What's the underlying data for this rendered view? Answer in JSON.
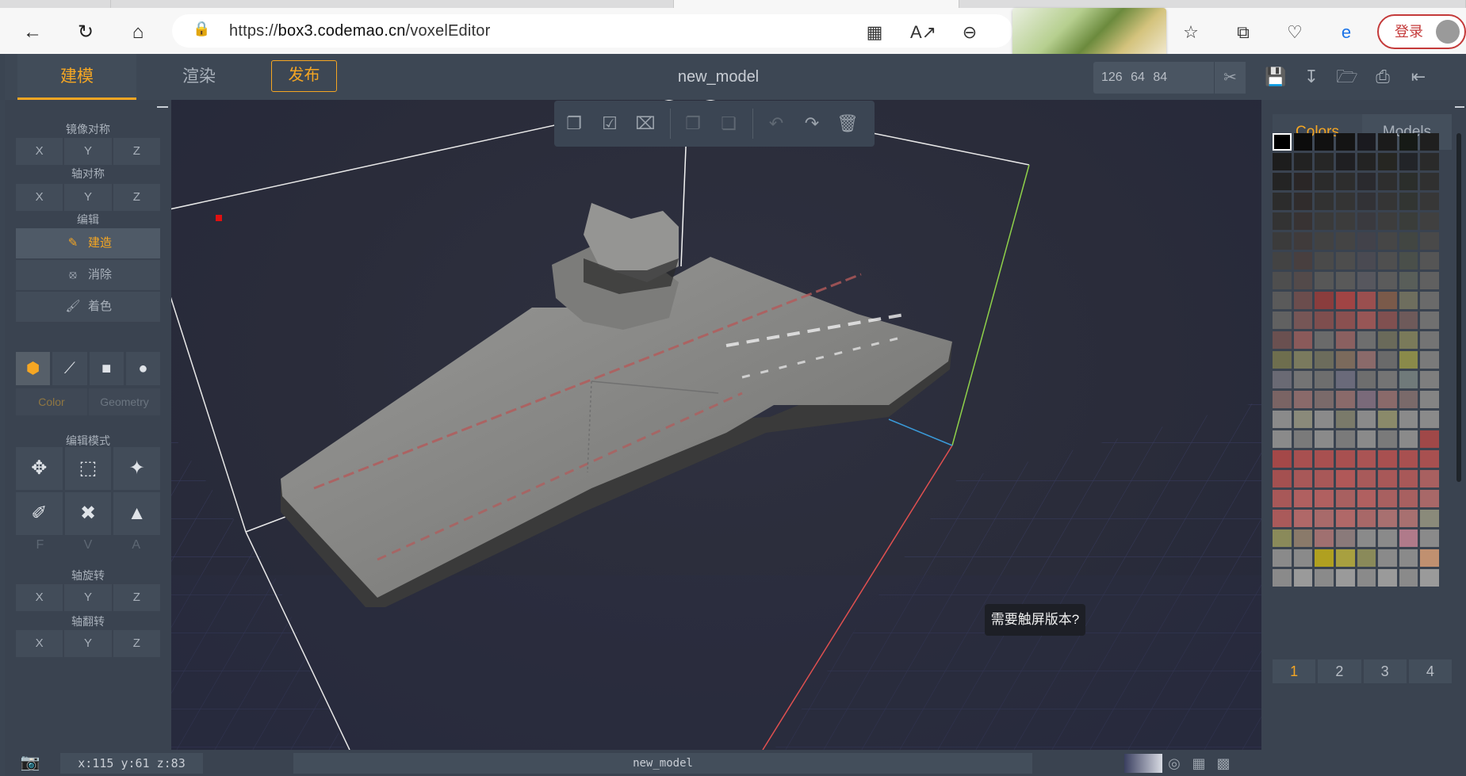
{
  "browser": {
    "url_prefix": "https://",
    "url_domain": "box3.codemao.cn",
    "url_path": "/voxelEditor",
    "login_label": "登录"
  },
  "topbar": {
    "tab_build": "建模",
    "tab_render": "渲染",
    "publish": "发布",
    "model_name": "new_model",
    "dims": "126 64 84"
  },
  "left": {
    "mirror_label": "镜像对称",
    "axis_sym_label": "轴对称",
    "edit_label": "编辑",
    "modes": [
      {
        "label": "建造",
        "icon": "build-icon"
      },
      {
        "label": "消除",
        "icon": "erase-icon"
      },
      {
        "label": "着色",
        "icon": "paint-icon"
      }
    ],
    "color_tab": "Color",
    "geometry_tab": "Geometry",
    "edit_mode_label": "编辑模式",
    "fva": [
      "F",
      "V",
      "A"
    ],
    "rotate_label": "轴旋转",
    "flip_label": "轴翻转",
    "axes": [
      "X",
      "Y",
      "Z"
    ]
  },
  "right": {
    "tab_colors": "Colors",
    "tab_models": "Models",
    "pages": [
      "1",
      "2",
      "3",
      "4"
    ],
    "palette": [
      "#000000",
      "#0c0c0c",
      "#111111",
      "#141414",
      "#1a1a1f",
      "#1b1b1b",
      "#161a16",
      "#1f1f1f",
      "#1d1d1d",
      "#222222",
      "#262626",
      "#1f1f22",
      "#232323",
      "#262622",
      "#222428",
      "#2a2a2a",
      "#242424",
      "#2a2626",
      "#2b2b2b",
      "#2d2d2d",
      "#2a2a2e",
      "#2e2e2e",
      "#2b2e2b",
      "#303030",
      "#2c2c2c",
      "#302c2c",
      "#323232",
      "#343434",
      "#323236",
      "#353535",
      "#323532",
      "#373737",
      "#333333",
      "#383333",
      "#3a3a3a",
      "#3c3c3c",
      "#3a3a3f",
      "#3d3d3d",
      "#3a3d3a",
      "#404040",
      "#3b3b3b",
      "#403b3b",
      "#424242",
      "#444444",
      "#42424a",
      "#464646",
      "#424642",
      "#494949",
      "#434343",
      "#483f3f",
      "#4a4a4a",
      "#4d4d4d",
      "#4a4a52",
      "#4f4f4f",
      "#4a4f4a",
      "#555555",
      "#4e4e4e",
      "#534a4a",
      "#575757",
      "#595959",
      "#57575e",
      "#5b5b5b",
      "#595e59",
      "#606060",
      "#5a5a5a",
      "#6b4d4d",
      "#8a3d3d",
      "#a04444",
      "#9a4f4f",
      "#7a5a4a",
      "#6e6e5e",
      "#6a6a6a",
      "#616161",
      "#765656",
      "#7e4e4e",
      "#8a5050",
      "#975656",
      "#805050",
      "#6e5a5a",
      "#707070",
      "#6a5050",
      "#8a5a5a",
      "#6a6a6a",
      "#8a6060",
      "#6e6e6e",
      "#6a6a5a",
      "#7a7a5a",
      "#747474",
      "#6e6e4e",
      "#7a7a5e",
      "#6c6c5c",
      "#7b6a5c",
      "#8a6a6a",
      "#6a6a6a",
      "#8a8a4a",
      "#7a7a7a",
      "#6a6a74",
      "#747474",
      "#6e6e6e",
      "#6a6a7a",
      "#6e6e6e",
      "#747474",
      "#707a7a",
      "#7e7e7e",
      "#7a6464",
      "#8a6a6a",
      "#7a6a6a",
      "#8a6a6a",
      "#7a6a7a",
      "#8a6a6a",
      "#7a6a6a",
      "#848484",
      "#8a8a8a",
      "#8a8a7a",
      "#8a8a8a",
      "#7a7a6a",
      "#8a8a8a",
      "#8a8a6a",
      "#8a8a8a",
      "#8a8a8a",
      "#8a8a8a",
      "#7a7a7a",
      "#8a8a8a",
      "#7a7a7a",
      "#8a8a8a",
      "#7a7a7a",
      "#8a8a8a",
      "#a04848",
      "#a44848",
      "#a85050",
      "#a85050",
      "#a85050",
      "#aa5454",
      "#a85050",
      "#a85050",
      "#a85050",
      "#a45050",
      "#a85858",
      "#a85858",
      "#b05858",
      "#a85a5a",
      "#a85858",
      "#a85858",
      "#a86060",
      "#a85858",
      "#b06060",
      "#b06060",
      "#a86060",
      "#b06060",
      "#a86060",
      "#a86060",
      "#a86868",
      "#aa5a5a",
      "#b06868",
      "#a86a6a",
      "#b06868",
      "#a86868",
      "#a87070",
      "#a87070",
      "#8a8a7a",
      "#8a8a5a",
      "#8a7a6a",
      "#a07070",
      "#8a7a7a",
      "#8a8a8a",
      "#8a8a8a",
      "#b07a8a",
      "#8a8a8a",
      "#8a8a8a",
      "#8a8a8a",
      "#b0a020",
      "#a8a040",
      "#8a8a5a",
      "#8a8a8a",
      "#8a8a8a",
      "#c09070",
      "#8a8a8a",
      "#9a9a9a",
      "#8a8a8a",
      "#9a9a9a",
      "#8a8a8a",
      "#9a9a9a",
      "#8a8a8a",
      "#9a9a9a"
    ]
  },
  "viewport": {
    "touch_hint": "需要触屏版本?"
  },
  "bottom": {
    "coords": "x:115 y:61 z:83",
    "name": "new_model"
  }
}
